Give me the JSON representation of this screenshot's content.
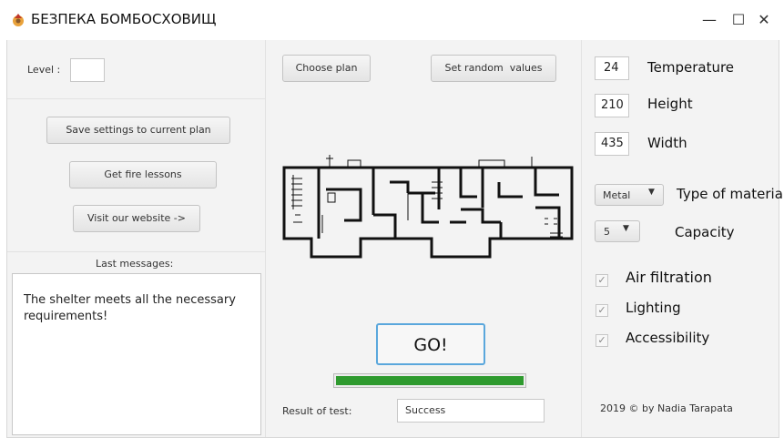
{
  "window": {
    "title": "БЕЗПЕКА БОМБОСХОВИЩ",
    "minimize": "—",
    "maximize": "☐",
    "close": "✕"
  },
  "left": {
    "level_label": "Level :",
    "level_value": "",
    "save_button": "Save settings to current plan",
    "fire_button": "Get fire lessons",
    "website_button": "Visit our website ->",
    "messages_header": "Last messages:",
    "message_text": "The shelter meets all the necessary requirements!"
  },
  "center": {
    "choose_plan_button": "Choose plan",
    "random_button": "Set random  values",
    "go_button": "GO!",
    "progress": 1.0,
    "progress_color": "#2e9a2e",
    "result_label": "Result of test:",
    "result_value": "Success"
  },
  "right": {
    "temperature_value": "24",
    "temperature_label": "Temperature",
    "height_value": "210",
    "height_label": "Height",
    "width_value": "435",
    "width_label": "Width",
    "material_value": "Metal",
    "material_label": "Type of material",
    "capacity_value": "5",
    "capacity_label": "Capacity",
    "air_filtration": "Air filtration",
    "lighting": "Lighting",
    "accessibility": "Accessibility",
    "footer": "2019 © by Nadia Tarapata"
  }
}
